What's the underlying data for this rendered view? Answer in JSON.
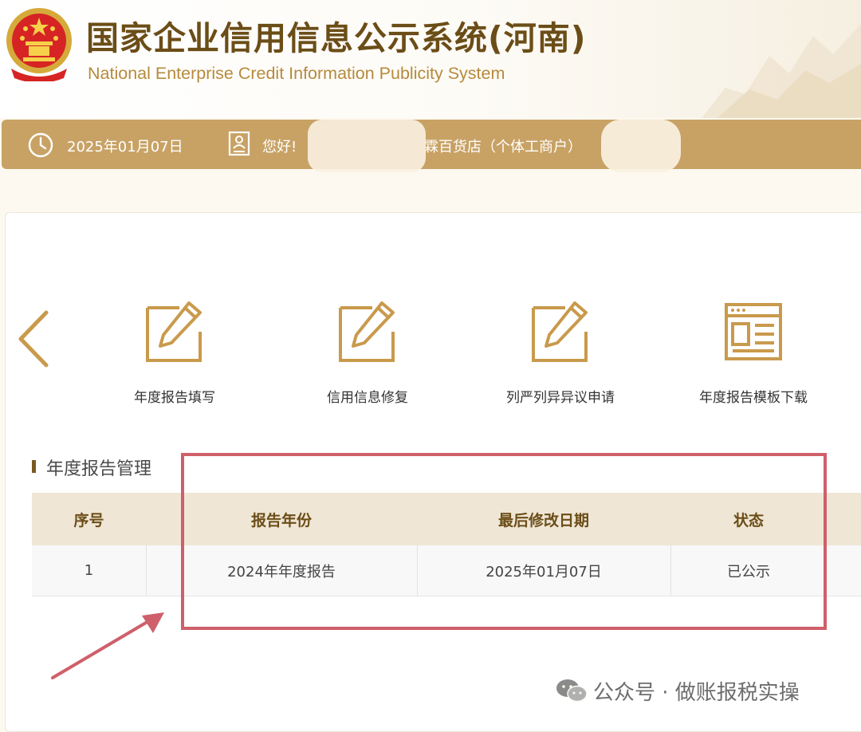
{
  "header": {
    "title_cn": "国家企业信用信息公示系统(河南)",
    "title_en": "National Enterprise Credit Information Publicity System"
  },
  "infobar": {
    "date": "2025年01月07日",
    "greeting": "您好!",
    "company_suffix": "霖百货店（个体工商户）"
  },
  "functions": [
    {
      "label": "年度报告填写",
      "icon": "edit-icon"
    },
    {
      "label": "信用信息修复",
      "icon": "edit-icon"
    },
    {
      "label": "列严列异异议申请",
      "icon": "edit-icon"
    },
    {
      "label": "年度报告模板下载",
      "icon": "template-icon"
    }
  ],
  "section": {
    "title": "年度报告管理"
  },
  "table": {
    "headers": [
      "序号",
      "报告年份",
      "最后修改日期",
      "状态"
    ],
    "rows": [
      [
        "1",
        "2024年年度报告",
        "2025年01月07日",
        "已公示"
      ]
    ]
  },
  "watermark": {
    "text": "公众号 · 做账报税实操"
  },
  "colors": {
    "brand_gold": "#c8a265",
    "brand_brown": "#6b4d17",
    "icon_gold": "#c99a4c",
    "highlight_red": "#cf5f6a"
  }
}
